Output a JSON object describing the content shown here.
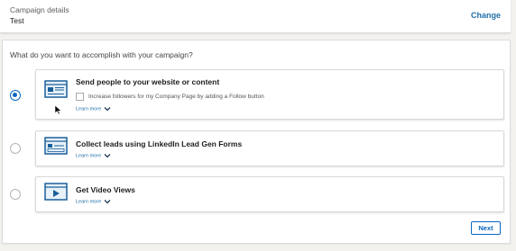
{
  "campaign": {
    "label": "Campaign details",
    "value": "Test",
    "change_label": "Change"
  },
  "objective": {
    "question": "What do you want to accomplish with your campaign?",
    "options": [
      {
        "title": "Send people to your website or content",
        "checkbox_label": "Increase followers for my Company Page by adding a Follow button",
        "learn_more": "Learn more",
        "icon": "website-icon",
        "selected": true
      },
      {
        "title": "Collect leads using LinkedIn Lead Gen Forms",
        "learn_more": "Learn more",
        "icon": "lead-form-icon",
        "selected": false
      },
      {
        "title": "Get Video Views",
        "learn_more": "Learn more",
        "icon": "video-icon",
        "selected": false
      }
    ],
    "next_label": "Next"
  },
  "colors": {
    "accent": "#0a66c2",
    "link": "#1f6fa8",
    "icon_fill": "#e8f1f8",
    "background": "#f3f2ef"
  }
}
